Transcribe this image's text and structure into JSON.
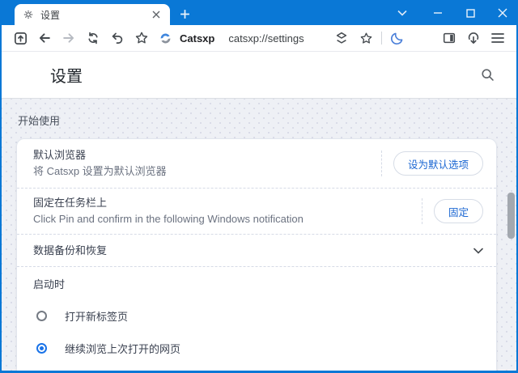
{
  "colors": {
    "titlebar_blue": "#0a78d6",
    "link_blue": "#1a66d2",
    "radio_selected": "#1a73e8",
    "moon_blue": "#4a7fd9"
  },
  "window": {
    "tab_title": "设置"
  },
  "toolbar": {
    "brand": "Catsxp",
    "url": "catsxp://settings"
  },
  "header": {
    "title": "设置"
  },
  "content": {
    "section_label": "开始使用",
    "rows": [
      {
        "title": "默认浏览器",
        "subtitle": "将 Catsxp 设置为默认浏览器",
        "button": "设为默认选项"
      },
      {
        "title": "固定在任务栏上",
        "subtitle": "Click Pin and confirm in the following Windows notification",
        "button": "固定"
      },
      {
        "title": "数据备份和恢复"
      }
    ],
    "startup": {
      "label": "启动时",
      "options": [
        {
          "label": "打开新标签页",
          "selected": false
        },
        {
          "label": "继续浏览上次打开的网页",
          "selected": true
        }
      ]
    }
  }
}
